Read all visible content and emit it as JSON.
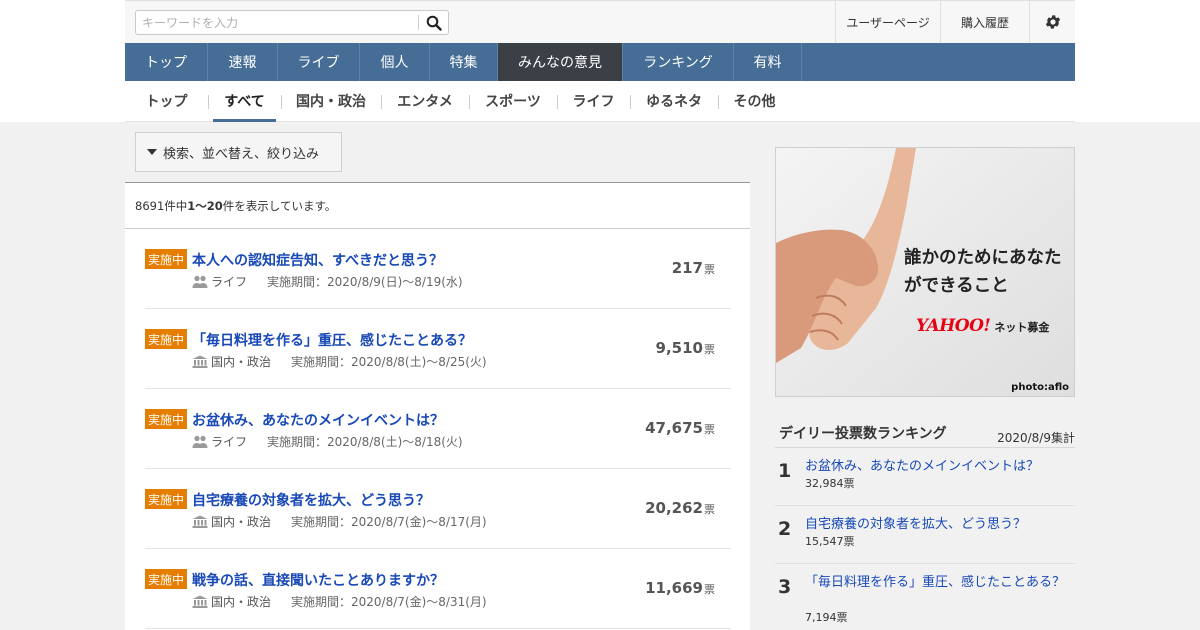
{
  "header": {
    "search_placeholder": "キーワードを入力",
    "search_icon": "search-icon",
    "user_page": "ユーザーページ",
    "purchase_history": "購入履歴",
    "settings_icon": "gear-icon"
  },
  "main_nav": [
    {
      "label": "トップ"
    },
    {
      "label": "速報"
    },
    {
      "label": "ライブ"
    },
    {
      "label": "個人"
    },
    {
      "label": "特集"
    },
    {
      "label": "みんなの意見"
    },
    {
      "label": "ランキング"
    },
    {
      "label": "有料"
    }
  ],
  "sub_nav": [
    {
      "label": "トップ"
    },
    {
      "label": "すべて"
    },
    {
      "label": "国内・政治"
    },
    {
      "label": "エンタメ"
    },
    {
      "label": "スポーツ"
    },
    {
      "label": "ライフ"
    },
    {
      "label": "ゆるネタ"
    },
    {
      "label": "その他"
    }
  ],
  "filter_button": "検索、並べ替え、絞り込み",
  "results": {
    "total": "8691",
    "total_suffix": "件中",
    "range": "1～20",
    "range_suffix": "件を表示しています。"
  },
  "polls": [
    {
      "status": "実施中",
      "title": "本人への認知症告知、すべきだと思う？",
      "category": "ライフ",
      "category_icon": "people-icon",
      "period": "実施期間：2020/8/9(日)〜8/19(水)",
      "votes": "217",
      "unit": "票"
    },
    {
      "status": "実施中",
      "title": "「毎日料理を作る」重圧、感じたことある？",
      "category": "国内・政治",
      "category_icon": "government-building-icon",
      "period": "実施期間：2020/8/8(土)〜8/25(火)",
      "votes": "9,510",
      "unit": "票"
    },
    {
      "status": "実施中",
      "title": "お盆休み、あなたのメインイベントは？",
      "category": "ライフ",
      "category_icon": "people-icon",
      "period": "実施期間：2020/8/8(土)〜8/18(火)",
      "votes": "47,675",
      "unit": "票"
    },
    {
      "status": "実施中",
      "title": "自宅療養の対象者を拡大、どう思う？",
      "category": "国内・政治",
      "category_icon": "government-building-icon",
      "period": "実施期間：2020/8/7(金)〜8/17(月)",
      "votes": "20,262",
      "unit": "票"
    },
    {
      "status": "実施中",
      "title": "戦争の話、直接聞いたことありますか？",
      "category": "国内・政治",
      "category_icon": "government-building-icon",
      "period": "実施期間：2020/8/7(金)〜8/31(月)",
      "votes": "11,669",
      "unit": "票"
    }
  ],
  "ad": {
    "line1": "誰かのためにあなたができること",
    "logo": "YAHOO!",
    "logo_sub": "ネット募金",
    "credit": "photo:aflo"
  },
  "ranking": {
    "title": "デイリー投票数ランキング",
    "date": "2020/8/9集計",
    "items": [
      {
        "rank": "1",
        "title": "お盆休み、あなたのメインイベントは？",
        "votes": "32,984票"
      },
      {
        "rank": "2",
        "title": "自宅療養の対象者を拡大、どう思う？",
        "votes": "15,547票"
      },
      {
        "rank": "3",
        "title": "「毎日料理を作る」重圧、感じたことある？",
        "votes": "7,194票"
      }
    ]
  }
}
